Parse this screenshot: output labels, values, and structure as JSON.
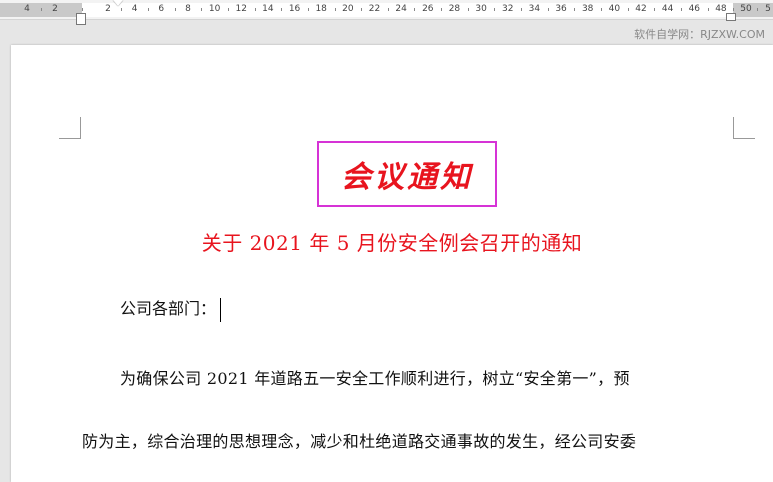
{
  "ruler": {
    "labels": [
      "4",
      "2",
      "2",
      "4",
      "6",
      "8",
      "10",
      "12",
      "14",
      "16",
      "18",
      "20",
      "22",
      "24",
      "26",
      "28",
      "30",
      "32",
      "34",
      "36",
      "38",
      "40",
      "42",
      "44",
      "46",
      "48",
      "50",
      "5"
    ]
  },
  "watermark": "软件自学网：RJZXW.COM",
  "document": {
    "title": "会议通知",
    "subtitle": "关于 2021 年 5 月份安全例会召开的通知",
    "salutation": "公司各部门：",
    "paragraph_line1": "为确保公司 2021 年道路五一安全工作顺利进行，树立“安全第一”，预",
    "paragraph_line2": "防为主，综合治理的思想理念，减少和杜绝道路交通事故的发生，经公司安委"
  },
  "colors": {
    "title_red": "#e8141e",
    "box_magenta": "#d633d6"
  }
}
